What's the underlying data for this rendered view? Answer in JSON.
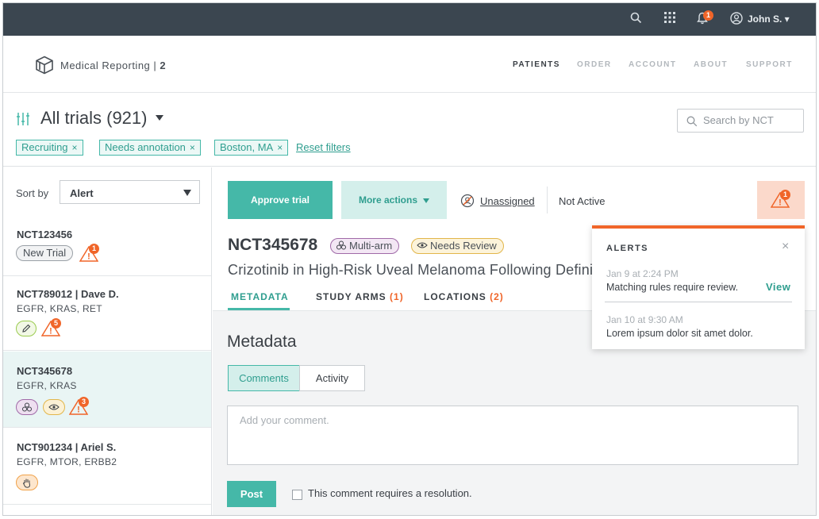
{
  "topbar": {
    "icons": [
      "search-icon",
      "grid-icon",
      "bell-icon",
      "user-icon"
    ],
    "notification_count": "1",
    "user_name": "John S. ▾"
  },
  "header": {
    "app_name": "Medical Reporting",
    "app_separator": " | ",
    "app_version": "2",
    "nav": [
      "PATIENTS",
      "ORDER",
      "ACCOUNT",
      "ABOUT",
      "SUPPORT"
    ],
    "active_nav": "PATIENTS"
  },
  "filters": {
    "title": "All trials (921)",
    "search_placeholder": "Search by NCT",
    "chips": [
      "Recruiting",
      "Needs annotation",
      "Boston, MA"
    ],
    "chip_remove": "×",
    "reset_label": "Reset filters"
  },
  "sidebar": {
    "sort_label": "Sort by",
    "sort_value": "Alert",
    "items": [
      {
        "title": "NCT123456",
        "subtitle": "",
        "badge_text": "New Trial",
        "alert_count": "1"
      },
      {
        "title": "NCT789012  |  Dave D.",
        "subtitle": "EGFR, KRAS, RET",
        "alert_count": "5"
      },
      {
        "title": "NCT345678",
        "subtitle": "EGFR, KRAS",
        "alert_count": "3"
      },
      {
        "title": "NCT901234  |  Ariel S.",
        "subtitle": "EGFR, MTOR, ERBB2"
      }
    ]
  },
  "main": {
    "approve_label": "Approve trial",
    "more_actions_label": "More actions",
    "unassigned_label": "Unassigned",
    "status_label": "Not Active",
    "alert_count": "1",
    "trial_id": "NCT345678",
    "tags": [
      "Multi-arm",
      "Needs Review"
    ],
    "trial_name": "Crizotinib in High-Risk Uveal Melanoma Following Definitive",
    "tabs": [
      {
        "label": "METADATA",
        "count": ""
      },
      {
        "label": "STUDY ARMS",
        "count": "(1)"
      },
      {
        "label": "LOCATIONS",
        "count": "(2)"
      }
    ],
    "section_title": "Metadata",
    "segments": [
      "Comments",
      "Activity"
    ],
    "comment_placeholder": "Add your comment.",
    "post_label": "Post",
    "resolution_label": "This comment requires a resolution."
  },
  "alerts_popover": {
    "title": "ALERTS",
    "close": "×",
    "items": [
      {
        "time": "Jan 9 at 2:24 PM",
        "message": "Matching rules require review.",
        "action": "View"
      },
      {
        "time": "Jan 10 at 9:30 AM",
        "message": "Lorem ipsum dolor sit amet dolor."
      }
    ]
  },
  "colors": {
    "topbar": "#3b4650",
    "accent_teal": "#45b8a8",
    "alert_orange": "#f06529"
  }
}
